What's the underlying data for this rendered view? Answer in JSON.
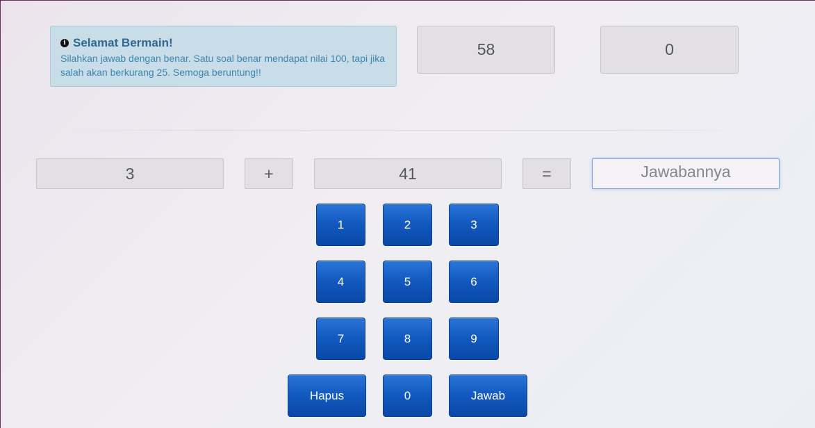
{
  "alert": {
    "icon": "info-icon",
    "title": "Selamat Bermain!",
    "message": "Silahkan jawab dengan benar. Satu soal benar mendapat nilai 100, tapi jika salah akan berkurang 25. Semoga beruntung!!"
  },
  "stats": {
    "timer": "58",
    "score": "0"
  },
  "equation": {
    "operand1": "3",
    "operator": "+",
    "operand2": "41",
    "equals": "="
  },
  "answer": {
    "value": "",
    "placeholder": "Jawabannya"
  },
  "keypad": {
    "k1": "1",
    "k2": "2",
    "k3": "3",
    "k4": "4",
    "k5": "5",
    "k6": "6",
    "k7": "7",
    "k8": "8",
    "k9": "9",
    "k0": "0",
    "delete": "Hapus",
    "submit": "Jawab"
  }
}
